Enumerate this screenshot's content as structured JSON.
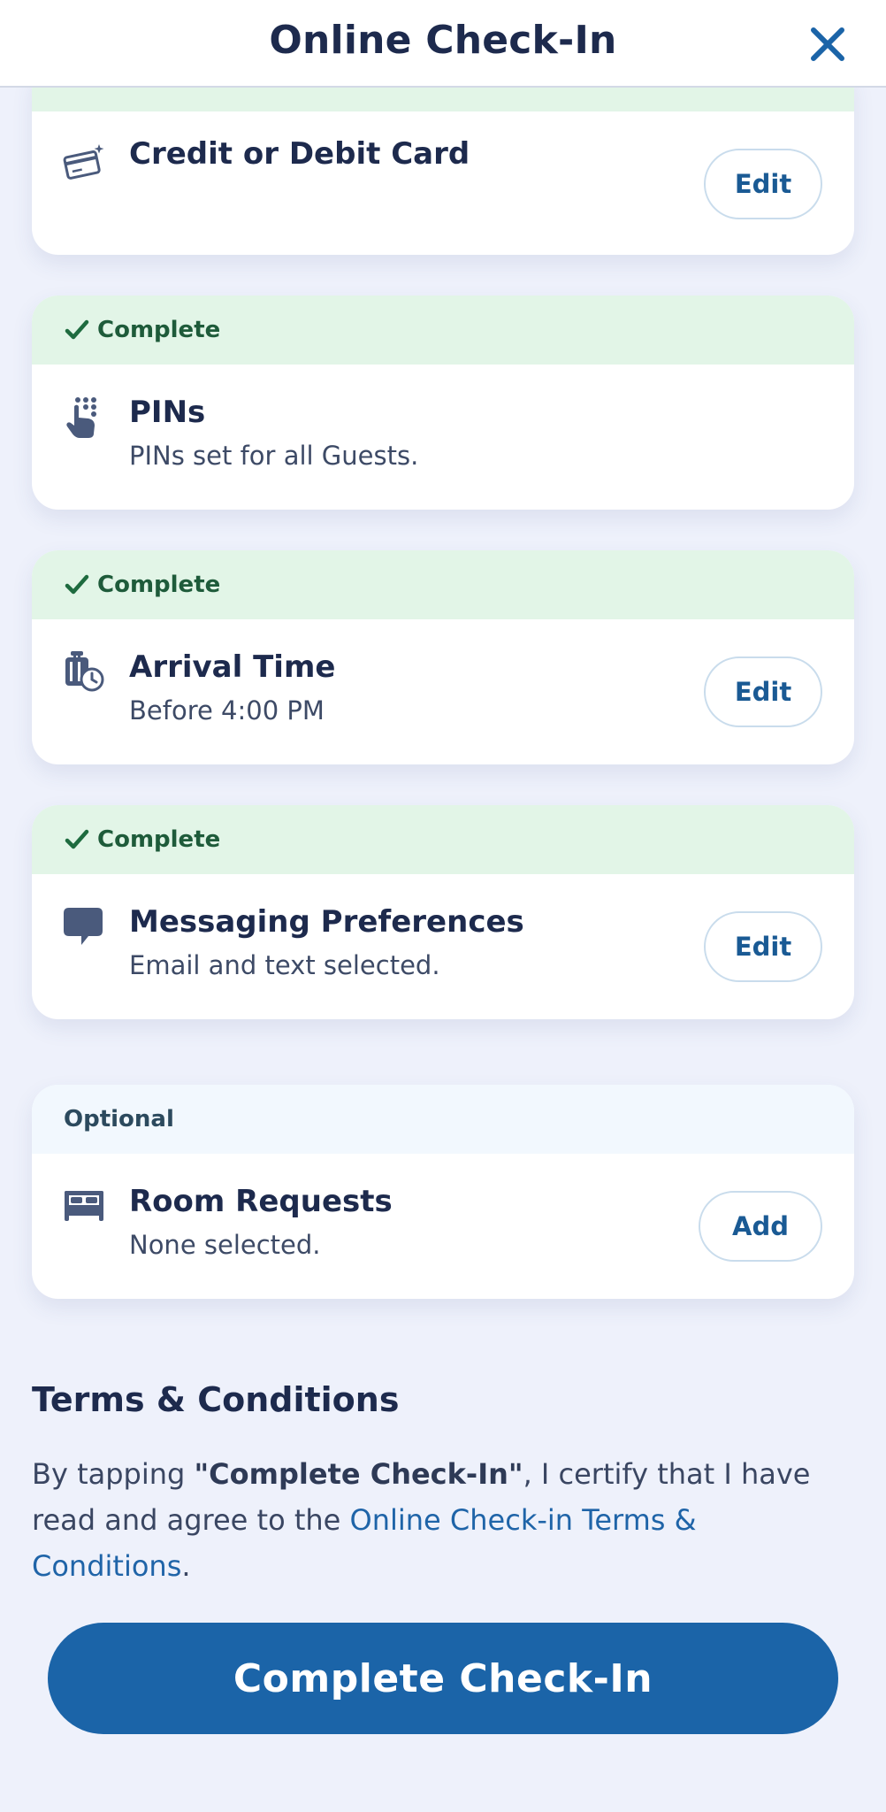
{
  "header": {
    "title": "Online Check-In",
    "close_icon": "close-icon"
  },
  "sections": {
    "payment": {
      "title": "Credit or Debit Card",
      "action": "Edit",
      "icon": "credit-card-icon"
    },
    "pins": {
      "status": "Complete",
      "title": "PINs",
      "subtitle": "PINs set for all Guests.",
      "icon": "keypad-hand-icon"
    },
    "arrival": {
      "status": "Complete",
      "title": "Arrival Time",
      "subtitle": "Before 4:00 PM",
      "action": "Edit",
      "icon": "luggage-clock-icon"
    },
    "messaging": {
      "status": "Complete",
      "title": "Messaging Preferences",
      "subtitle": "Email and text selected.",
      "action": "Edit",
      "icon": "chat-bubble-icon"
    },
    "room_requests": {
      "status": "Optional",
      "title": "Room Requests",
      "subtitle": "None selected.",
      "action": "Add",
      "icon": "bed-icon"
    }
  },
  "terms": {
    "title": "Terms & Conditions",
    "text_before": "By tapping ",
    "bold_text": "\"Complete Check-In\"",
    "text_middle": ", I certify that I have read and agree to the ",
    "link_text": "Online Check-in Terms & Conditions",
    "text_after": "."
  },
  "complete_button": {
    "label": "Complete Check-In"
  },
  "colors": {
    "page_background": "#eef1fb",
    "complete_banner": "#e2f5e7",
    "complete_text": "#1e5b3a",
    "optional_banner": "#f2f8fe",
    "primary_blue": "#1b64a8",
    "title_navy": "#1d2a4d"
  }
}
